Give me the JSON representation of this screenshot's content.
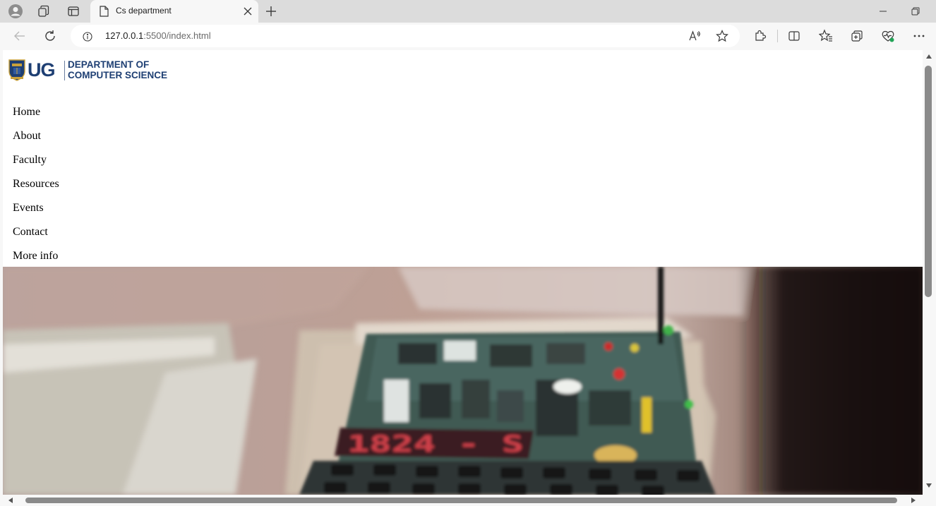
{
  "browser": {
    "tab": {
      "title": "Cs department"
    },
    "address": {
      "host": "127.0.0.1",
      "path": ":5500/index.html"
    }
  },
  "page": {
    "logo": {
      "short": "UG",
      "line1": "DEPARTMENT OF",
      "line2": "COMPUTER SCIENCE"
    },
    "nav": [
      {
        "label": "Home"
      },
      {
        "label": "About"
      },
      {
        "label": "Faculty"
      },
      {
        "label": "Resources"
      },
      {
        "label": "Events"
      },
      {
        "label": "Contact"
      },
      {
        "label": "More info"
      }
    ],
    "hero": {
      "display_text": "1824 - S"
    }
  },
  "colors": {
    "brand": "#1e3f73",
    "display_red": "#e8454f"
  }
}
